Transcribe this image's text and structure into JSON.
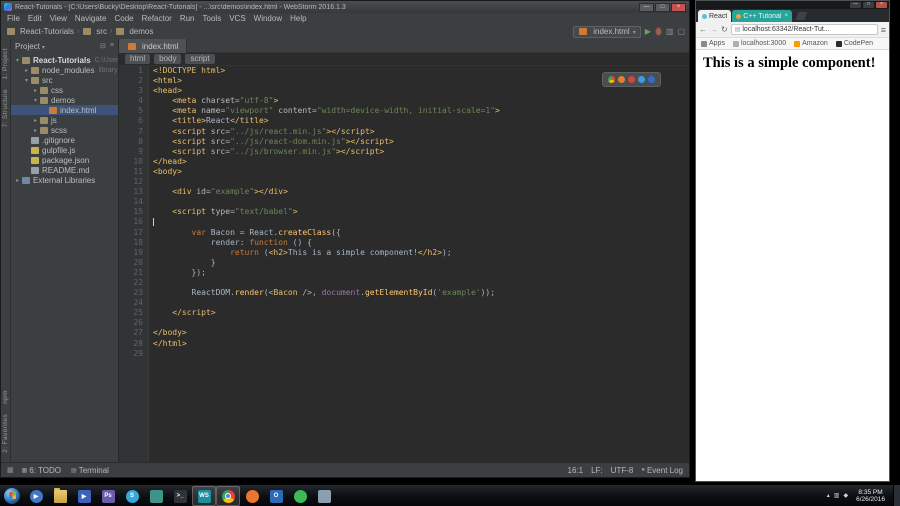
{
  "webstorm": {
    "window_title": "React-Tutorials - [C:\\Users\\Bucky\\Desktop\\React-Tutorials] - ...\\src\\demos\\index.html - WebStorm 2016.1.3",
    "window_controls": {
      "minimize": "—",
      "maximize": "□",
      "close": "×"
    },
    "menu": [
      "File",
      "Edit",
      "View",
      "Navigate",
      "Code",
      "Refactor",
      "Run",
      "Tools",
      "VCS",
      "Window",
      "Help"
    ],
    "breadcrumbs": [
      {
        "label": "React-Tutorials"
      },
      {
        "label": "src"
      },
      {
        "label": "demos"
      }
    ],
    "editor_tab": {
      "label": "index.html"
    },
    "run_config": {
      "label": "index.html"
    },
    "tool_tabs_top": [
      {
        "label": "1: Project"
      },
      {
        "label": "7: Structure"
      }
    ],
    "tool_tabs_bottom": [
      {
        "label": "npm"
      },
      {
        "label": "2: Favorites"
      }
    ],
    "project": {
      "header": "Project",
      "tree": [
        {
          "label": "React-Tutorials",
          "suffix": "C:\\Users\\Bucky...",
          "depth": 0,
          "icon": "root",
          "chevron": "▾",
          "bold": true
        },
        {
          "label": "node_modules",
          "suffix": "library root",
          "depth": 1,
          "icon": "folder",
          "chevron": "▸"
        },
        {
          "label": "src",
          "depth": 1,
          "icon": "folder",
          "chevron": "▾"
        },
        {
          "label": "css",
          "depth": 2,
          "icon": "folder",
          "chevron": "▸"
        },
        {
          "label": "demos",
          "depth": 2,
          "icon": "folder",
          "chevron": "▾"
        },
        {
          "label": "index.html",
          "depth": 3,
          "icon": "html",
          "selected": true
        },
        {
          "label": "js",
          "depth": 2,
          "icon": "folder",
          "chevron": "▸"
        },
        {
          "label": "scss",
          "depth": 2,
          "icon": "folder",
          "chevron": "▸"
        },
        {
          "label": ".gitignore",
          "depth": 1,
          "icon": "file"
        },
        {
          "label": "gulpfile.js",
          "depth": 1,
          "icon": "js"
        },
        {
          "label": "package.json",
          "depth": 1,
          "icon": "json"
        },
        {
          "label": "README.md",
          "depth": 1,
          "icon": "file"
        },
        {
          "label": "External Libraries",
          "depth": 0,
          "icon": "lib",
          "chevron": "▸"
        }
      ]
    },
    "tag_path": [
      "html",
      "body",
      "script"
    ],
    "browser_popup": [
      {
        "name": "chrome",
        "color": ""
      },
      {
        "name": "firefox",
        "color": "#e87c2d"
      },
      {
        "name": "opera",
        "color": "#d1463d"
      },
      {
        "name": "ie",
        "color": "#3d9ae8"
      },
      {
        "name": "edge",
        "color": "#2f6fc0"
      }
    ],
    "caret_line": 16,
    "code": [
      [
        [
          "tag",
          "<!DOCTYPE html>"
        ]
      ],
      [
        [
          "tag",
          "<html>"
        ]
      ],
      [
        [
          "tag",
          "<head>"
        ]
      ],
      [
        [
          "pl",
          "    "
        ],
        [
          "tag",
          "<meta"
        ],
        [
          "attr",
          " charset"
        ],
        [
          "pl",
          "="
        ],
        [
          "str",
          "\"utf-8\""
        ],
        [
          "tag",
          ">"
        ]
      ],
      [
        [
          "pl",
          "    "
        ],
        [
          "tag",
          "<meta"
        ],
        [
          "attr",
          " name"
        ],
        [
          "pl",
          "="
        ],
        [
          "str",
          "\"viewport\""
        ],
        [
          "attr",
          " content"
        ],
        [
          "pl",
          "="
        ],
        [
          "str",
          "\"width=device-width, initial-scale=1\""
        ],
        [
          "tag",
          ">"
        ]
      ],
      [
        [
          "pl",
          "    "
        ],
        [
          "tag",
          "<title>"
        ],
        [
          "pl",
          "React"
        ],
        [
          "tag",
          "</title>"
        ]
      ],
      [
        [
          "pl",
          "    "
        ],
        [
          "tag",
          "<script"
        ],
        [
          "attr",
          " src"
        ],
        [
          "pl",
          "="
        ],
        [
          "str",
          "\"../js/react.min.js\""
        ],
        [
          "tag",
          "></script>"
        ]
      ],
      [
        [
          "pl",
          "    "
        ],
        [
          "tag",
          "<script"
        ],
        [
          "attr",
          " src"
        ],
        [
          "pl",
          "="
        ],
        [
          "str",
          "\"../js/react-dom.min.js\""
        ],
        [
          "tag",
          "></script>"
        ]
      ],
      [
        [
          "pl",
          "    "
        ],
        [
          "tag",
          "<script"
        ],
        [
          "attr",
          " src"
        ],
        [
          "pl",
          "="
        ],
        [
          "str",
          "\"../js/browser.min.js\""
        ],
        [
          "tag",
          "></script>"
        ]
      ],
      [
        [
          "tag",
          "</head>"
        ]
      ],
      [
        [
          "tag",
          "<body>"
        ]
      ],
      [],
      [
        [
          "pl",
          "    "
        ],
        [
          "tag",
          "<div"
        ],
        [
          "attr",
          " id"
        ],
        [
          "pl",
          "="
        ],
        [
          "str",
          "\"example\""
        ],
        [
          "tag",
          "></div>"
        ]
      ],
      [],
      [
        [
          "pl",
          "    "
        ],
        [
          "tag",
          "<script"
        ],
        [
          "attr",
          " type"
        ],
        [
          "pl",
          "="
        ],
        [
          "str",
          "\"text/babel\""
        ],
        [
          "tag",
          ">"
        ]
      ],
      [],
      [
        [
          "pl",
          "        "
        ],
        [
          "kw",
          "var"
        ],
        [
          "pl",
          " Bacon = React."
        ],
        [
          "fn",
          "createClass"
        ],
        [
          "pl",
          "({"
        ]
      ],
      [
        [
          "pl",
          "            render: "
        ],
        [
          "kw",
          "function"
        ],
        [
          "pl",
          " () {"
        ]
      ],
      [
        [
          "pl",
          "                "
        ],
        [
          "kw",
          "return"
        ],
        [
          "pl",
          " ("
        ],
        [
          "tag",
          "<h2>"
        ],
        [
          "pl",
          "This is a simple component!"
        ],
        [
          "tag",
          "</h2>"
        ],
        [
          "pl",
          ");"
        ]
      ],
      [
        [
          "pl",
          "            }"
        ]
      ],
      [
        [
          "pl",
          "        });"
        ]
      ],
      [],
      [
        [
          "pl",
          "        ReactDOM."
        ],
        [
          "fn",
          "render"
        ],
        [
          "pl",
          "(<"
        ],
        [
          "tag",
          "Bacon"
        ],
        [
          "pl",
          " />, "
        ],
        [
          "glob",
          "document"
        ],
        [
          "pl",
          "."
        ],
        [
          "fn",
          "getElementById"
        ],
        [
          "pl",
          "("
        ],
        [
          "str",
          "'example'"
        ],
        [
          "pl",
          "));"
        ]
      ],
      [],
      [
        [
          "pl",
          "    "
        ],
        [
          "tag",
          "</script>"
        ]
      ],
      [],
      [
        [
          "tag",
          "</body>"
        ]
      ],
      [
        [
          "tag",
          "</html>"
        ]
      ],
      []
    ],
    "status_left": [
      {
        "glyph": "▦",
        "label": "6: TODO"
      },
      {
        "glyph": "▤",
        "label": "Terminal"
      }
    ],
    "status_right": [
      {
        "label": "16:1"
      },
      {
        "label": "LF:"
      },
      {
        "label": "UTF-8"
      },
      {
        "glyph": "●",
        "label": "Event Log"
      }
    ]
  },
  "browser": {
    "window_controls": {
      "minimize": "—",
      "maximize": "□",
      "close": "×"
    },
    "tabs": [
      {
        "title": "React",
        "active": true,
        "favicon_color": "#5bc0de"
      },
      {
        "title": "C++ Tutorial",
        "active": false,
        "bg": "#26a69a",
        "favicon_color": "#f4a040"
      }
    ],
    "address": "localhost:63342/React-Tut...",
    "bookmarks": [
      {
        "label": "Apps",
        "color": "#8a8a8a"
      },
      {
        "label": "localhost:3000",
        "color": "#aab0b6"
      },
      {
        "label": "Amazon",
        "color": "#ff9900"
      },
      {
        "label": "CodePen",
        "color": "#2b2b2b"
      }
    ],
    "heading": "This is a simple component!"
  },
  "taskbar": {
    "icons": [
      {
        "name": "media-center",
        "shape": "ci",
        "color": "#3f77c9",
        "glyph": "▶"
      },
      {
        "name": "file-explorer",
        "shape": "folder",
        "color": "",
        "glyph": ""
      },
      {
        "name": "media-player",
        "shape": "sq",
        "color": "#3a62b8",
        "glyph": "▶"
      },
      {
        "name": "photoshop",
        "shape": "sq",
        "color": "#6a5ca8",
        "glyph": "Ps"
      },
      {
        "name": "skype",
        "shape": "ci",
        "color": "#35a8dc",
        "glyph": "S"
      },
      {
        "name": "notepad",
        "shape": "sq",
        "color": "#3f9488",
        "glyph": ""
      },
      {
        "name": "cmd",
        "shape": "sq",
        "color": "#2e3338",
        "glyph": ">_"
      },
      {
        "name": "webstorm",
        "shape": "sq",
        "color": "#1e8f9f",
        "glyph": "WS",
        "active": true
      },
      {
        "name": "chrome",
        "shape": "chrome",
        "color": "",
        "glyph": "",
        "active": true
      },
      {
        "name": "firefox",
        "shape": "ci",
        "color": "#e8762d",
        "glyph": ""
      },
      {
        "name": "outlook",
        "shape": "sq",
        "color": "#2b6cb8",
        "glyph": "O"
      },
      {
        "name": "spotify",
        "shape": "ci",
        "color": "#3dba55",
        "glyph": ""
      },
      {
        "name": "snipping-tool",
        "shape": "sq",
        "color": "#8aa0b0",
        "glyph": ""
      }
    ],
    "tray_icons": [
      {
        "glyph": "▴"
      },
      {
        "glyph": "▥"
      },
      {
        "glyph": "◆"
      }
    ],
    "clock": {
      "time": "8:35 PM",
      "date": "6/26/2016"
    }
  }
}
